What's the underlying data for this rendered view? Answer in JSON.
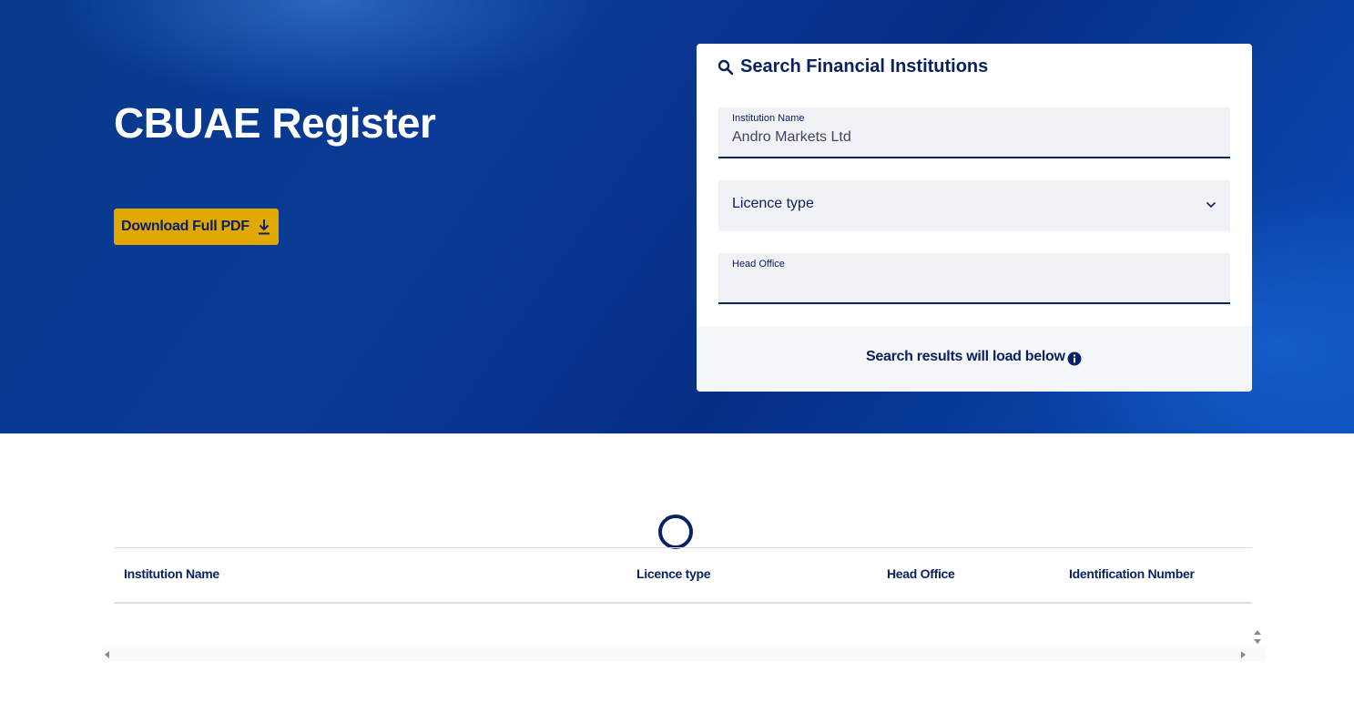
{
  "hero": {
    "title": "CBUAE Register",
    "download_label": "Download Full PDF"
  },
  "search": {
    "heading": "Search Financial Institutions",
    "institution_name": {
      "label": "Institution Name",
      "value": "Andro Markets Ltd"
    },
    "licence_type": {
      "placeholder": "Licence type"
    },
    "head_office": {
      "label": "Head Office",
      "value": ""
    },
    "info_message": "Search results will load below"
  },
  "results": {
    "columns": [
      "Institution Name",
      "Licence type",
      "Head Office",
      "Identification Number"
    ]
  },
  "colors": {
    "brand_navy": "#0b2161",
    "hero_blue": "#0a3a96",
    "accent_gold": "#e0a800"
  },
  "icons": {
    "download": "download-icon",
    "search": "search-icon",
    "dropdown": "chevron-down-icon",
    "info": "info-icon",
    "loading": "loading-spinner"
  }
}
